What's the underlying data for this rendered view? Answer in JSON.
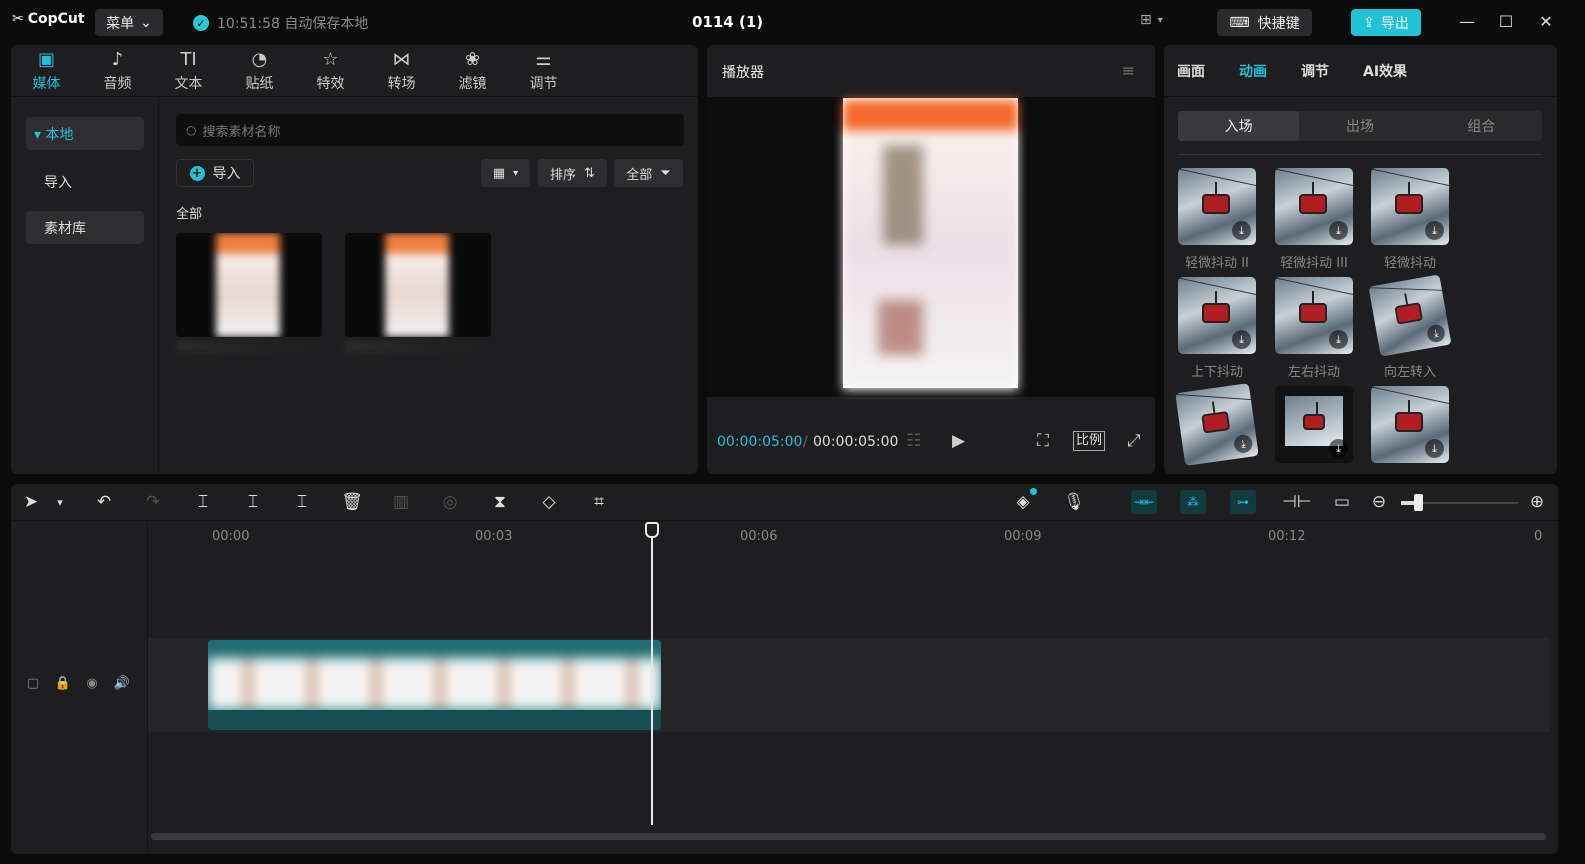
{
  "titlebar": {
    "logo": "CopCut",
    "menu_label": "菜单",
    "save_status": "10:51:58 自动保存本地",
    "project_title": "0114 (1)",
    "shortcut_label": "快捷键",
    "export_label": "导出",
    "accent": "#21c1d6"
  },
  "media": {
    "tabs": [
      {
        "icon": "▣",
        "label": "媒体"
      },
      {
        "icon": "♪",
        "label": "音频"
      },
      {
        "icon": "TI",
        "label": "文本"
      },
      {
        "icon": "◔",
        "label": "贴纸"
      },
      {
        "icon": "☆",
        "label": "特效"
      },
      {
        "icon": "⋈",
        "label": "转场"
      },
      {
        "icon": "❀",
        "label": "滤镜"
      },
      {
        "icon": "⚌",
        "label": "调节"
      }
    ],
    "sidebar": {
      "local": "▾ 本地",
      "import": "导入",
      "library": "素材库"
    },
    "search_placeholder": "搜索素材名称",
    "import_label": "导入",
    "sort_label": "排序",
    "filter_label": "全部",
    "section_label": "全部"
  },
  "player": {
    "title": "播放器",
    "current_time": "00:00:05:00",
    "separator": "/",
    "total_time": "00:00:05:00",
    "ratio_label": "比例"
  },
  "inspector": {
    "tabs": [
      "画面",
      "动画",
      "调节",
      "AI效果"
    ],
    "subtabs": [
      "入场",
      "出场",
      "组合"
    ],
    "animations": [
      {
        "label": "轻微抖动 II"
      },
      {
        "label": "轻微抖动 III"
      },
      {
        "label": "轻微抖动"
      },
      {
        "label": "上下抖动"
      },
      {
        "label": "左右抖动"
      },
      {
        "label": "向左转入"
      },
      {
        "label": ""
      },
      {
        "label": ""
      },
      {
        "label": ""
      }
    ]
  },
  "timeline": {
    "ruler_labels": [
      "00:00",
      "00:03",
      "00:06",
      "00:09",
      "00:12",
      "0"
    ]
  }
}
